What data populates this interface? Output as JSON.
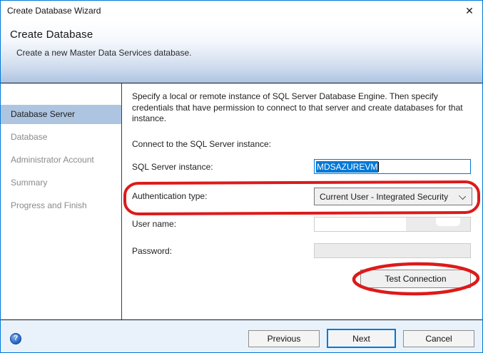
{
  "window": {
    "title": "Create Database Wizard",
    "close_glyph": "✕"
  },
  "header": {
    "title": "Create Database",
    "subtitle": "Create a new Master Data Services database."
  },
  "sidebar": {
    "items": [
      {
        "label": "Database Server",
        "selected": true
      },
      {
        "label": "Database",
        "selected": false
      },
      {
        "label": "Administrator Account",
        "selected": false
      },
      {
        "label": "Summary",
        "selected": false
      },
      {
        "label": "Progress and Finish",
        "selected": false
      }
    ]
  },
  "content": {
    "description": "Specify a local or remote instance of SQL Server Database Engine. Then specify credentials that have permission to connect to that server and create databases for that instance.",
    "connect_label": "Connect to the SQL Server instance:",
    "fields": {
      "instance": {
        "label": "SQL Server instance:",
        "value": "MDSAZUREVM",
        "state": "focused, text selected"
      },
      "auth": {
        "label": "Authentication type:",
        "value": "Current User - Integrated Security"
      },
      "username": {
        "label": "User name:",
        "value": "",
        "state": "disabled, redacted"
      },
      "password": {
        "label": "Password:",
        "value": "",
        "state": "disabled"
      }
    },
    "test_button_label": "Test Connection"
  },
  "footer": {
    "help_glyph": "?",
    "previous_label": "Previous",
    "next_label": "Next",
    "cancel_label": "Cancel"
  },
  "colors": {
    "accent": "#0078D7",
    "selection_bg": "#0078D7",
    "annotation_red": "#DD1A1A",
    "header_gradient_bottom": "#AEC4E2",
    "sidebar_selected_bg": "#AEC5E2",
    "footer_bg": "#E9F2FB",
    "disabled_field_bg": "#EBEBEB"
  }
}
